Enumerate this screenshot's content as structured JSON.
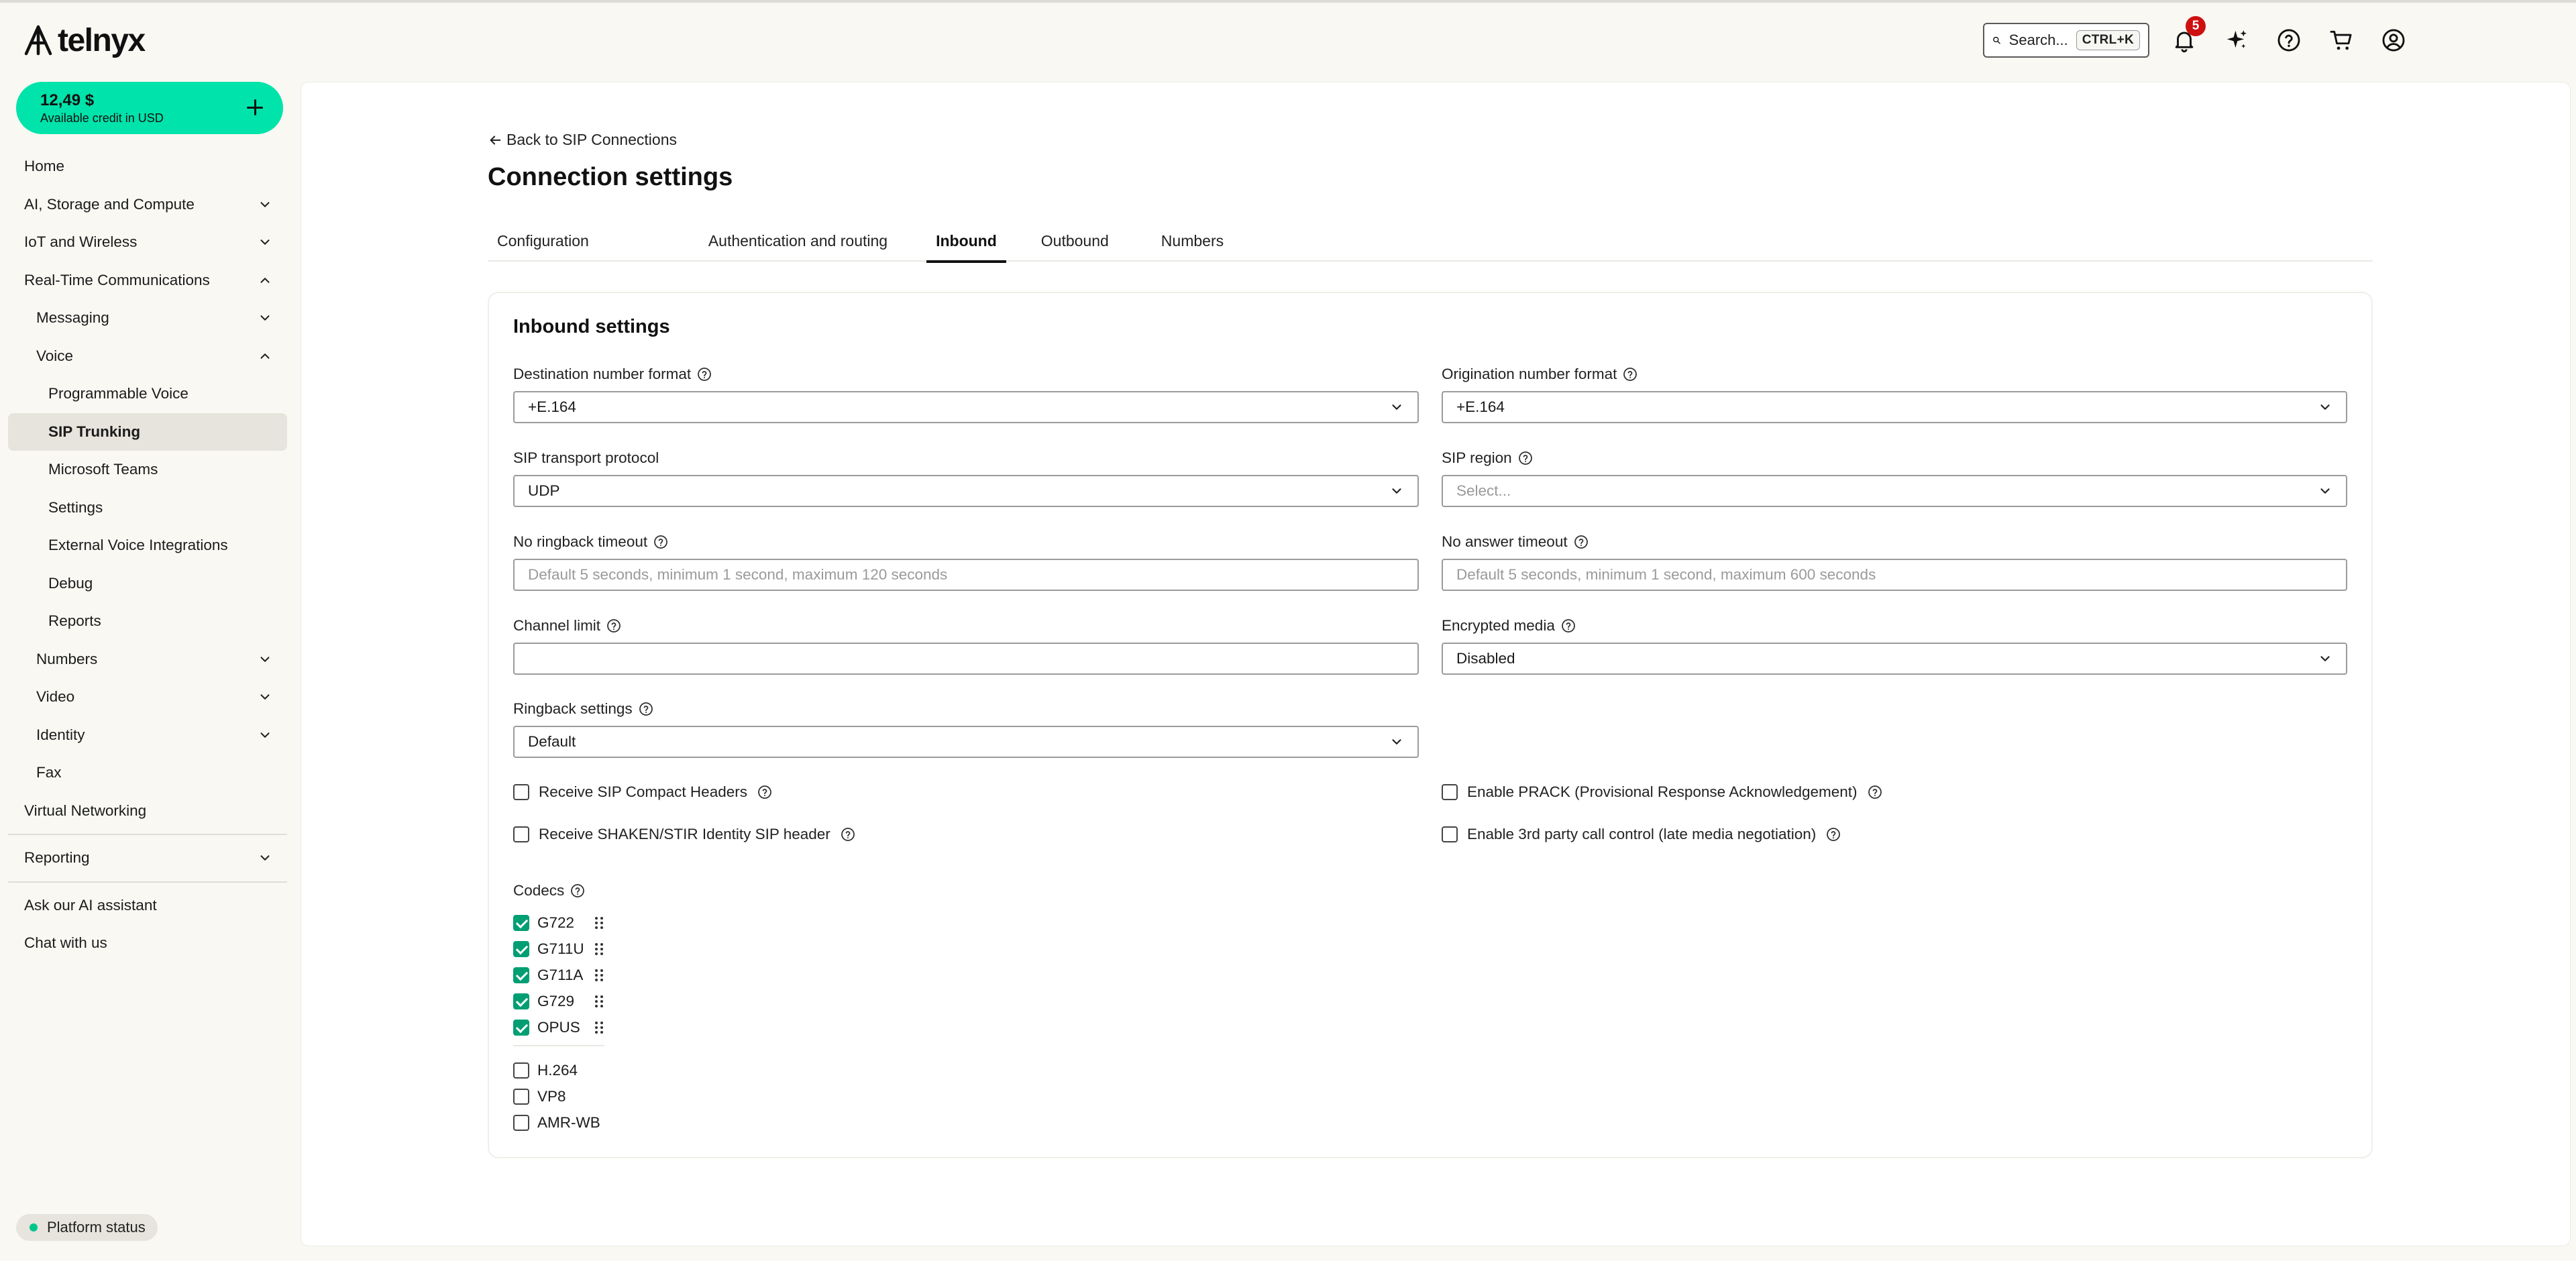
{
  "brand": {
    "name": "telnyx",
    "accent": "#00e3aa"
  },
  "topbar": {
    "search_label": "Search...",
    "search_shortcut": "CTRL+K",
    "notifications_count": "5"
  },
  "credit": {
    "amount": "12,49 $",
    "label": "Available credit in USD"
  },
  "sidebar": {
    "items": [
      {
        "label": "Home"
      },
      {
        "label": "AI, Storage and Compute"
      },
      {
        "label": "IoT and Wireless"
      },
      {
        "label": "Real-Time Communications"
      },
      {
        "label": "Messaging"
      },
      {
        "label": "Voice"
      },
      {
        "label": "Programmable Voice"
      },
      {
        "label": "SIP Trunking"
      },
      {
        "label": "Microsoft Teams"
      },
      {
        "label": "Settings"
      },
      {
        "label": "External Voice Integrations"
      },
      {
        "label": "Debug"
      },
      {
        "label": "Reports"
      },
      {
        "label": "Numbers"
      },
      {
        "label": "Video"
      },
      {
        "label": "Identity"
      },
      {
        "label": "Fax"
      },
      {
        "label": "Virtual Networking"
      },
      {
        "label": "Reporting"
      },
      {
        "label": "Ask our AI assistant"
      },
      {
        "label": "Chat with us"
      }
    ],
    "platform_status": "Platform status"
  },
  "main": {
    "back_link": "Back to SIP Connections",
    "title": "Connection settings",
    "tabs": [
      "Configuration",
      "Authentication and routing",
      "Inbound",
      "Outbound",
      "Numbers"
    ],
    "active_tab": "Inbound"
  },
  "inbound": {
    "title": "Inbound settings",
    "destination_number_format": {
      "label": "Destination number format",
      "value": "+E.164"
    },
    "origination_number_format": {
      "label": "Origination number format",
      "value": "+E.164"
    },
    "sip_transport_protocol": {
      "label": "SIP transport protocol",
      "value": "UDP"
    },
    "sip_region": {
      "label": "SIP region",
      "placeholder": "Select..."
    },
    "no_ringback_timeout": {
      "label": "No ringback timeout",
      "placeholder": "Default 5 seconds, minimum 1 second, maximum 120 seconds",
      "value": ""
    },
    "no_answer_timeout": {
      "label": "No answer timeout",
      "placeholder": "Default 5 seconds, minimum 1 second, maximum 600 seconds",
      "value": ""
    },
    "channel_limit": {
      "label": "Channel limit",
      "value": ""
    },
    "encrypted_media": {
      "label": "Encrypted media",
      "value": "Disabled"
    },
    "ringback_settings": {
      "label": "Ringback settings",
      "value": "Default"
    },
    "checkboxes": {
      "compact_headers": {
        "label": "Receive SIP Compact Headers",
        "checked": false
      },
      "shaken_stir": {
        "label": "Receive SHAKEN/STIR Identity SIP header",
        "checked": false
      },
      "prack": {
        "label": "Enable PRACK (Provisional Response Acknowledgement)",
        "checked": false
      },
      "third_party": {
        "label": "Enable 3rd party call control (late media negotiation)",
        "checked": false
      }
    },
    "codecs_label": "Codecs",
    "codecs_enabled": [
      {
        "name": "G722",
        "checked": true
      },
      {
        "name": "G711U",
        "checked": true
      },
      {
        "name": "G711A",
        "checked": true
      },
      {
        "name": "G729",
        "checked": true
      },
      {
        "name": "OPUS",
        "checked": true
      }
    ],
    "codecs_disabled": [
      {
        "name": "H.264",
        "checked": false
      },
      {
        "name": "VP8",
        "checked": false
      },
      {
        "name": "AMR-WB",
        "checked": false
      }
    ]
  }
}
